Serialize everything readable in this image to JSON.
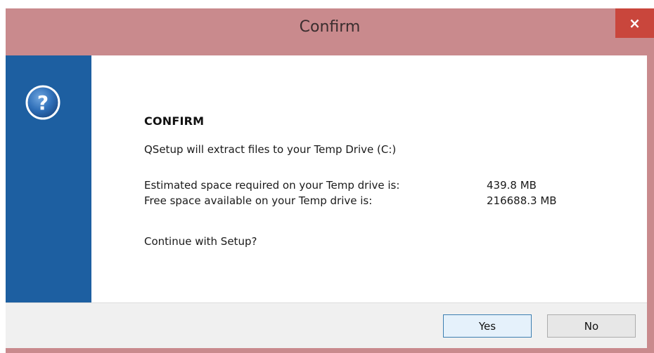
{
  "window": {
    "title": "Confirm",
    "close_label": "×"
  },
  "icon": {
    "name": "question-icon",
    "glyph": "?"
  },
  "message": {
    "heading": "CONFIRM",
    "extract_line": "QSetup will extract files to your Temp Drive (C:)",
    "required_label": "Estimated space required on your Temp drive is:",
    "required_value": "439.8 MB",
    "free_label": "Free space available on your Temp drive is:",
    "free_value": "216688.3 MB",
    "prompt": "Continue with Setup?"
  },
  "buttons": {
    "yes": "Yes",
    "no": "No"
  },
  "colors": {
    "titlebar": "#c98a8d",
    "close_button": "#c9463c",
    "side_band": "#1d5fa1",
    "footer": "#f0f0f0"
  }
}
